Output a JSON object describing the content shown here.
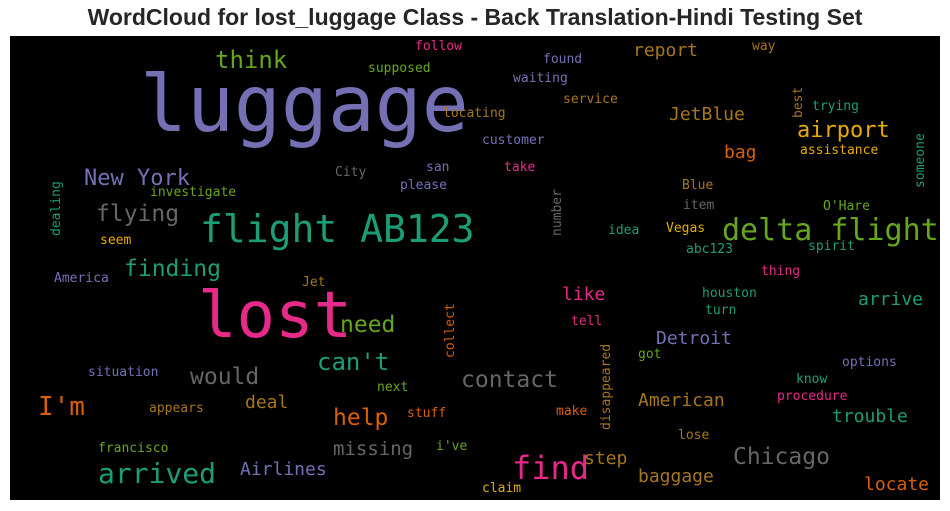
{
  "chart_data": {
    "type": "wordcloud",
    "title": "WordCloud for lost_luggage Class - Back Translation-Hindi Testing Set",
    "background": "#000000",
    "palette": {
      "purple": "#7570b3",
      "teal": "#1b9e77",
      "pink": "#e7298a",
      "orange": "#d95f02",
      "green": "#66a61e",
      "gold": "#e6ab02",
      "brown": "#a6761d",
      "gray": "#666666"
    },
    "words": [
      {
        "text": "luggage",
        "weight": 1.0,
        "color": "#7570b3",
        "vertical": false
      },
      {
        "text": "lost",
        "weight": 0.95,
        "color": "#e7298a",
        "vertical": false
      },
      {
        "text": "flight AB123",
        "weight": 0.6,
        "color": "#1b9e77",
        "vertical": false
      },
      {
        "text": "delta flight",
        "weight": 0.5,
        "color": "#66a61e",
        "vertical": false
      },
      {
        "text": "find",
        "weight": 0.4,
        "color": "#e7298a",
        "vertical": false
      },
      {
        "text": "arrived",
        "weight": 0.38,
        "color": "#1b9e77",
        "vertical": false
      },
      {
        "text": "I'm",
        "weight": 0.38,
        "color": "#d95f02",
        "vertical": false
      },
      {
        "text": "contact",
        "weight": 0.32,
        "color": "#666666",
        "vertical": false
      },
      {
        "text": "Chicago",
        "weight": 0.32,
        "color": "#666666",
        "vertical": false
      },
      {
        "text": "can't",
        "weight": 0.32,
        "color": "#1b9e77",
        "vertical": false
      },
      {
        "text": "would",
        "weight": 0.3,
        "color": "#666666",
        "vertical": false
      },
      {
        "text": "help",
        "weight": 0.3,
        "color": "#d95f02",
        "vertical": false
      },
      {
        "text": "think",
        "weight": 0.3,
        "color": "#66a61e",
        "vertical": false
      },
      {
        "text": "finding",
        "weight": 0.3,
        "color": "#1b9e77",
        "vertical": false
      },
      {
        "text": "airport",
        "weight": 0.3,
        "color": "#e6ab02",
        "vertical": false
      },
      {
        "text": "flying",
        "weight": 0.28,
        "color": "#666666",
        "vertical": false
      },
      {
        "text": "New York",
        "weight": 0.27,
        "color": "#7570b3",
        "vertical": false
      },
      {
        "text": "need",
        "weight": 0.27,
        "color": "#66a61e",
        "vertical": false
      },
      {
        "text": "missing",
        "weight": 0.22,
        "color": "#666666",
        "vertical": false
      },
      {
        "text": "Airlines",
        "weight": 0.22,
        "color": "#7570b3",
        "vertical": false
      },
      {
        "text": "baggage",
        "weight": 0.22,
        "color": "#a6761d",
        "vertical": false
      },
      {
        "text": "American",
        "weight": 0.22,
        "color": "#a6761d",
        "vertical": false
      },
      {
        "text": "trouble",
        "weight": 0.22,
        "color": "#1b9e77",
        "vertical": false
      },
      {
        "text": "Detroit",
        "weight": 0.22,
        "color": "#7570b3",
        "vertical": false
      },
      {
        "text": "arrive",
        "weight": 0.22,
        "color": "#1b9e77",
        "vertical": false
      },
      {
        "text": "locate",
        "weight": 0.22,
        "color": "#d95f02",
        "vertical": false
      },
      {
        "text": "JetBlue",
        "weight": 0.2,
        "color": "#a6761d",
        "vertical": false
      },
      {
        "text": "report",
        "weight": 0.2,
        "color": "#a6761d",
        "vertical": false
      },
      {
        "text": "bag",
        "weight": 0.2,
        "color": "#d95f02",
        "vertical": false
      },
      {
        "text": "step",
        "weight": 0.2,
        "color": "#a6761d",
        "vertical": false
      },
      {
        "text": "deal",
        "weight": 0.18,
        "color": "#a6761d",
        "vertical": false
      },
      {
        "text": "like",
        "weight": 0.18,
        "color": "#e7298a",
        "vertical": false
      },
      {
        "text": "waiting",
        "weight": 0.13,
        "color": "#7570b3",
        "vertical": false
      },
      {
        "text": "found",
        "weight": 0.13,
        "color": "#7570b3",
        "vertical": false
      },
      {
        "text": "supposed",
        "weight": 0.13,
        "color": "#66a61e",
        "vertical": false
      },
      {
        "text": "follow",
        "weight": 0.13,
        "color": "#e7298a",
        "vertical": false
      },
      {
        "text": "way",
        "weight": 0.13,
        "color": "#a6761d",
        "vertical": false
      },
      {
        "text": "service",
        "weight": 0.13,
        "color": "#a6761d",
        "vertical": false
      },
      {
        "text": "locating",
        "weight": 0.13,
        "color": "#a6761d",
        "vertical": false
      },
      {
        "text": "customer",
        "weight": 0.13,
        "color": "#7570b3",
        "vertical": false
      },
      {
        "text": "trying",
        "weight": 0.13,
        "color": "#1b9e77",
        "vertical": false
      },
      {
        "text": "assistance",
        "weight": 0.13,
        "color": "#e6ab02",
        "vertical": false
      },
      {
        "text": "take",
        "weight": 0.13,
        "color": "#e7298a",
        "vertical": false
      },
      {
        "text": "san",
        "weight": 0.13,
        "color": "#7570b3",
        "vertical": false
      },
      {
        "text": "City",
        "weight": 0.13,
        "color": "#666666",
        "vertical": false
      },
      {
        "text": "please",
        "weight": 0.13,
        "color": "#7570b3",
        "vertical": false
      },
      {
        "text": "investigate",
        "weight": 0.13,
        "color": "#66a61e",
        "vertical": false
      },
      {
        "text": "Blue",
        "weight": 0.13,
        "color": "#a6761d",
        "vertical": false
      },
      {
        "text": "O'Hare",
        "weight": 0.13,
        "color": "#66a61e",
        "vertical": false
      },
      {
        "text": "item",
        "weight": 0.13,
        "color": "#666666",
        "vertical": false
      },
      {
        "text": "idea",
        "weight": 0.13,
        "color": "#1b9e77",
        "vertical": false
      },
      {
        "text": "Vegas",
        "weight": 0.13,
        "color": "#e6ab02",
        "vertical": false
      },
      {
        "text": "spirit",
        "weight": 0.13,
        "color": "#1b9e77",
        "vertical": false
      },
      {
        "text": "seem",
        "weight": 0.13,
        "color": "#e6ab02",
        "vertical": false
      },
      {
        "text": "abc123",
        "weight": 0.13,
        "color": "#1b9e77",
        "vertical": false
      },
      {
        "text": "America",
        "weight": 0.13,
        "color": "#7570b3",
        "vertical": false
      },
      {
        "text": "Jet",
        "weight": 0.13,
        "color": "#a6761d",
        "vertical": false
      },
      {
        "text": "thing",
        "weight": 0.13,
        "color": "#e7298a",
        "vertical": false
      },
      {
        "text": "houston",
        "weight": 0.13,
        "color": "#1b9e77",
        "vertical": false
      },
      {
        "text": "turn",
        "weight": 0.13,
        "color": "#1b9e77",
        "vertical": false
      },
      {
        "text": "tell",
        "weight": 0.13,
        "color": "#e7298a",
        "vertical": false
      },
      {
        "text": "got",
        "weight": 0.13,
        "color": "#66a61e",
        "vertical": false
      },
      {
        "text": "options",
        "weight": 0.13,
        "color": "#7570b3",
        "vertical": false
      },
      {
        "text": "situation",
        "weight": 0.13,
        "color": "#7570b3",
        "vertical": false
      },
      {
        "text": "next",
        "weight": 0.13,
        "color": "#66a61e",
        "vertical": false
      },
      {
        "text": "know",
        "weight": 0.13,
        "color": "#1b9e77",
        "vertical": false
      },
      {
        "text": "procedure",
        "weight": 0.13,
        "color": "#e7298a",
        "vertical": false
      },
      {
        "text": "appears",
        "weight": 0.13,
        "color": "#a6761d",
        "vertical": false
      },
      {
        "text": "stuff",
        "weight": 0.13,
        "color": "#d95f02",
        "vertical": false
      },
      {
        "text": "make",
        "weight": 0.13,
        "color": "#d95f02",
        "vertical": false
      },
      {
        "text": "francisco",
        "weight": 0.13,
        "color": "#66a61e",
        "vertical": false
      },
      {
        "text": "i've",
        "weight": 0.13,
        "color": "#66a61e",
        "vertical": false
      },
      {
        "text": "lose",
        "weight": 0.13,
        "color": "#a6761d",
        "vertical": false
      },
      {
        "text": "claim",
        "weight": 0.13,
        "color": "#e6ab02",
        "vertical": false
      },
      {
        "text": "dealing",
        "weight": 0.13,
        "color": "#1b9e77",
        "vertical": true
      },
      {
        "text": "number",
        "weight": 0.13,
        "color": "#666666",
        "vertical": true
      },
      {
        "text": "best",
        "weight": 0.13,
        "color": "#a6761d",
        "vertical": true
      },
      {
        "text": "someone",
        "weight": 0.13,
        "color": "#1b9e77",
        "vertical": true
      },
      {
        "text": "collect",
        "weight": 0.13,
        "color": "#d95f02",
        "vertical": true
      },
      {
        "text": "disappeared",
        "weight": 0.13,
        "color": "#a6761d",
        "vertical": true
      }
    ]
  }
}
